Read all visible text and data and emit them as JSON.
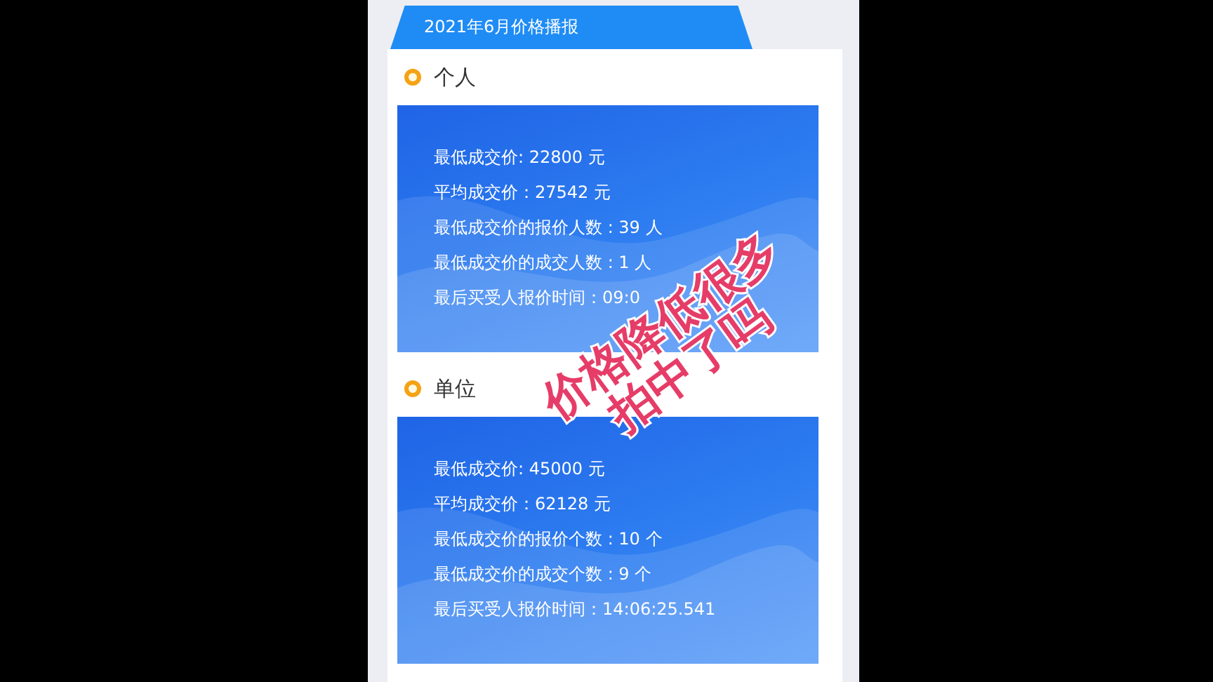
{
  "header": {
    "title": "2021年6月价格播报"
  },
  "sections": [
    {
      "title": "个人",
      "lines": [
        "最低成交价: 22800 元",
        "平均成交价：27542 元",
        "最低成交价的报价人数 : 39 人",
        "最低成交价的成交人数 : 1 人",
        "最后买受人报价时间：09:0"
      ]
    },
    {
      "title": "单位",
      "lines": [
        "最低成交价: 45000 元",
        "平均成交价：62128 元",
        "最低成交价的报价个数 : 10 个",
        "最低成交价的成交个数 : 9 个",
        "最后买受人报价时间：14:06:25.541"
      ]
    }
  ],
  "caption": {
    "lines": [
      "价格降低很多",
      "拍中了吗"
    ]
  }
}
